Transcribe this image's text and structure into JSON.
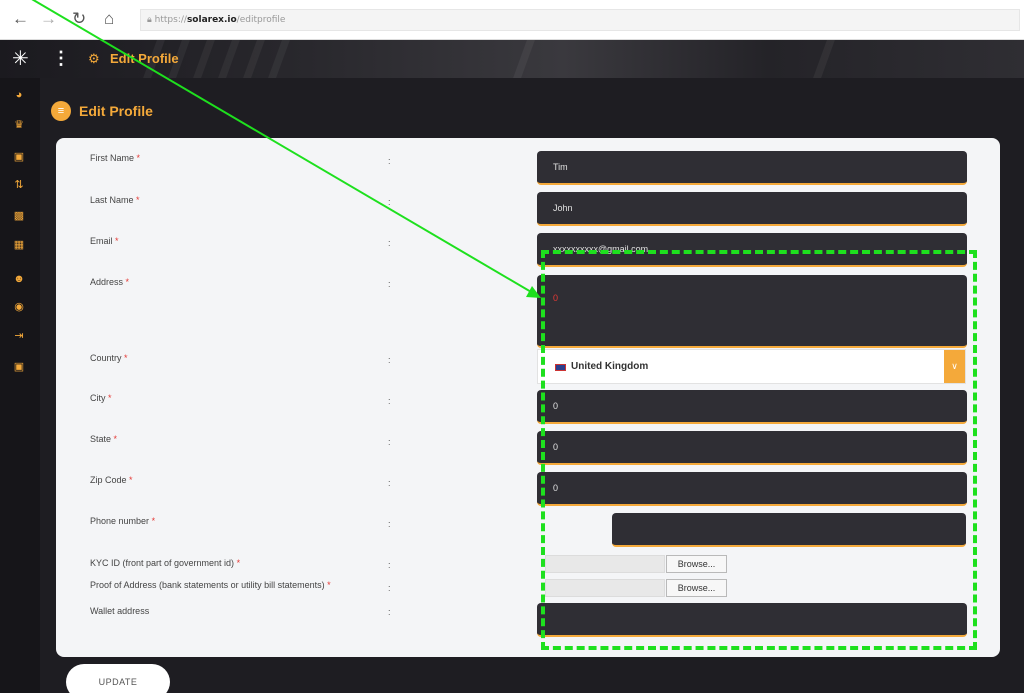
{
  "browser": {
    "url_prefix": "https://",
    "url_domain": "solarex.io",
    "url_path": "/editprofile"
  },
  "header": {
    "logo_icon": "network-logo-icon",
    "menu_icon": "kebab-menu-icon",
    "title": "Edit Profile",
    "title_icon": "dashboard-gauge-icon"
  },
  "sidebar": {
    "icons": [
      "dashboard-icon",
      "crown-icon",
      "wallet-icon",
      "transfer-icon",
      "chat-icon",
      "report-icon",
      "user-icon",
      "support-icon",
      "logout-icon",
      "lock-icon"
    ]
  },
  "page": {
    "title": "Edit Profile"
  },
  "form": {
    "first_name_label": "First Name",
    "first_name_value": "Tim",
    "last_name_label": "Last Name",
    "last_name_value": "John",
    "email_label": "Email",
    "email_value": "xxxxxxxxxx@gmail.com",
    "address_label": "Address",
    "address_value": "0",
    "country_label": "Country",
    "country_value": "United Kingdom",
    "city_label": "City",
    "city_value": "0",
    "state_label": "State",
    "state_value": "0",
    "zip_label": "Zip Code",
    "zip_value": "0",
    "phone_label": "Phone number",
    "phone_value": "",
    "kyc_label": "KYC ID (front part of government id)",
    "poa_label": "Proof of Address (bank statements or utility bill statements)",
    "wallet_label": "Wallet address",
    "wallet_value": "",
    "required_mark": "*",
    "colon": ":",
    "browse_label": "Browse...",
    "update_label": "UPDATE"
  },
  "colors": {
    "accent": "#f4a93a",
    "field_bg": "#2f2e34",
    "highlight": "#1ee01e"
  }
}
